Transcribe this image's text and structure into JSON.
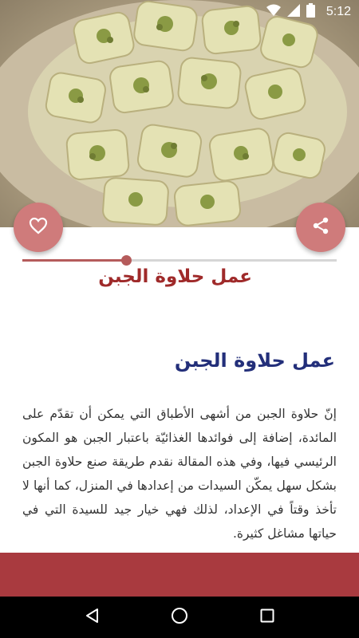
{
  "status_bar": {
    "time": "5:12"
  },
  "hero": {
    "image_alt": "dessert-photo"
  },
  "actions": {
    "favorite_icon": "heart-outline-icon",
    "share_icon": "share-icon"
  },
  "reading_progress": {
    "value": 0.33
  },
  "page": {
    "title": "عمل حلاوة الجبن"
  },
  "article": {
    "heading": "عمل حلاوة الجبن",
    "body": "إنّ حلاوة الجبن من أشهى الأطباق التي يمكن أن تقدّم على المائدة، إضافة إلى فوائدها الغذائيّة باعتبار الجبن هو المكون الرئيسي فيها، وفي هذه المقالة نقدم طريقة صنع حلاوة الجبن بشكل سهل يمكّن السيدات من إعدادها في المنزل، كما أنها لا تأخذ وقتاً في الإعداد، لذلك فهي خيار جيد للسيدة التي في حياتها مشاغل كثيرة."
  },
  "colors": {
    "accent": "#cf7b7b",
    "title": "#9f2a2a",
    "heading": "#232f7a",
    "band": "#a93a3f"
  },
  "nav": {
    "back_icon": "back-triangle-icon",
    "home_icon": "home-circle-icon",
    "recents_icon": "recents-square-icon"
  }
}
